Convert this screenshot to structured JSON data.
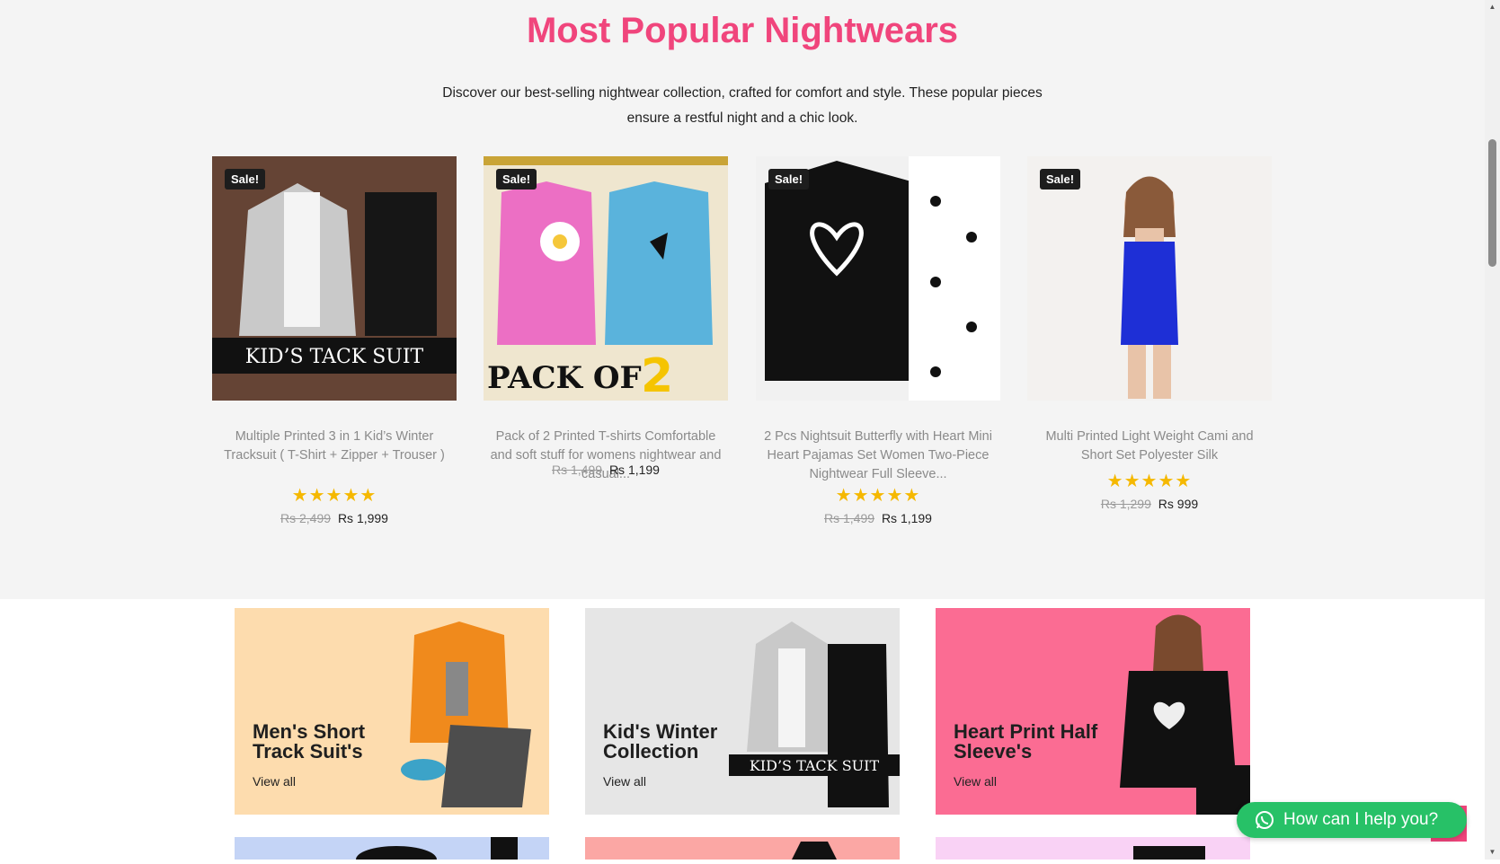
{
  "section": {
    "title": "Most Popular Nightwears",
    "description_line1": "Discover our best-selling nightwear collection, crafted for comfort and style. These popular pieces",
    "description_line2": "ensure a restful night and a chic look."
  },
  "products": [
    {
      "badge": "Sale!",
      "image_caption": "KID’S TACK SUIT",
      "title": "Multiple Printed 3 in 1 Kid’s Winter Tracksuit ( T-Shirt + Zipper + Trouser )",
      "rating_stars": "★★★★★",
      "rating": 5,
      "old_price": "Rs 2,499",
      "price": "Rs 1,999"
    },
    {
      "badge": "Sale!",
      "image_caption": "PACK OF",
      "image_caption_num": "2",
      "title": "Pack of 2 Printed T-shirts Comfortable and soft stuff for womens nightwear and casual...",
      "rating_stars": "",
      "old_price": "Rs 1,499",
      "price": "Rs 1,199"
    },
    {
      "badge": "Sale!",
      "title": "2 Pcs Nightsuit Butterfly with Heart Mini Heart Pajamas Set Women Two-Piece Nightwear Full Sleeve...",
      "rating_stars": "★★★★★",
      "rating": 5,
      "old_price": "Rs 1,499",
      "price": "Rs 1,199"
    },
    {
      "badge": "Sale!",
      "title": "Multi Printed Light Weight Cami and Short Set Polyester Silk",
      "rating_stars": "★★★★★",
      "rating": 5,
      "old_price": "Rs 1,299",
      "price": "Rs 999"
    }
  ],
  "categories": [
    {
      "name": "Men's Short Track Suit's",
      "link": "View all",
      "bg": "#fddcae"
    },
    {
      "name": "Kid's Winter Collection",
      "link": "View all",
      "bg": "#e6e6e6",
      "image_caption": "KID’S TACK SUIT"
    },
    {
      "name": "Heart Print Half Sleeve's",
      "link": "View all",
      "bg": "#fb6c93"
    }
  ],
  "row2_colors": [
    "#c4d4f6",
    "#fba7a4",
    "#f9d2f5"
  ],
  "whatsapp": {
    "label": "How can I help you?",
    "icon": "whatsapp-icon"
  },
  "colors": {
    "accent": "#f0457c",
    "star": "#f5b800",
    "whatsapp": "#27c167"
  }
}
